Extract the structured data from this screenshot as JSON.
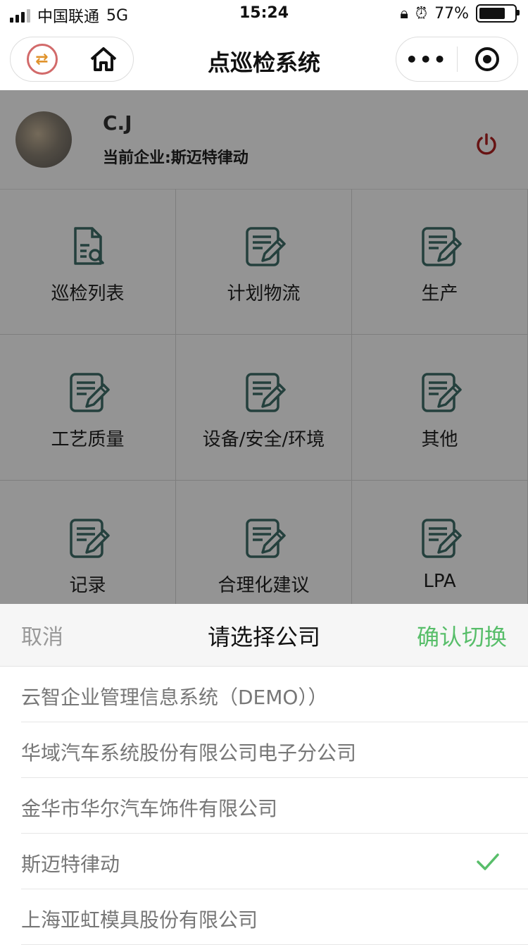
{
  "status_bar": {
    "carrier": "中国联通",
    "network": "5G",
    "time": "15:24",
    "battery": "77%"
  },
  "nav": {
    "title": "点巡检系统",
    "more_icon": "more-dots-icon",
    "close_icon": "target-icon"
  },
  "user": {
    "name": "C.J",
    "company": "当前企业:斯迈特律动"
  },
  "grid": [
    {
      "label": "巡检列表",
      "icon": "document-search-icon"
    },
    {
      "label": "计划物流",
      "icon": "edit-document-icon"
    },
    {
      "label": "生产",
      "icon": "edit-document-icon"
    },
    {
      "label": "工艺质量",
      "icon": "edit-document-icon"
    },
    {
      "label": "设备/安全/环境",
      "icon": "edit-document-icon"
    },
    {
      "label": "其他",
      "icon": "edit-document-icon"
    },
    {
      "label": "记录",
      "icon": "edit-document-icon"
    },
    {
      "label": "合理化建议",
      "icon": "edit-document-icon"
    },
    {
      "label": "LPA",
      "icon": "edit-document-icon"
    }
  ],
  "picker": {
    "cancel": "取消",
    "title": "请选择公司",
    "confirm": "确认切换",
    "options": [
      {
        "label": "云智企业管理信息系统（DEMO））",
        "selected": false
      },
      {
        "label": "华域汽车系统股份有限公司电子分公司",
        "selected": false
      },
      {
        "label": "金华市华尔汽车饰件有限公司",
        "selected": false
      },
      {
        "label": "斯迈特律动",
        "selected": true
      },
      {
        "label": "上海亚虹模具股份有限公司",
        "selected": false
      }
    ]
  },
  "colors": {
    "accent_green": "#58be6a",
    "icon_teal": "#3f6f6a",
    "power_red": "#b22222"
  }
}
